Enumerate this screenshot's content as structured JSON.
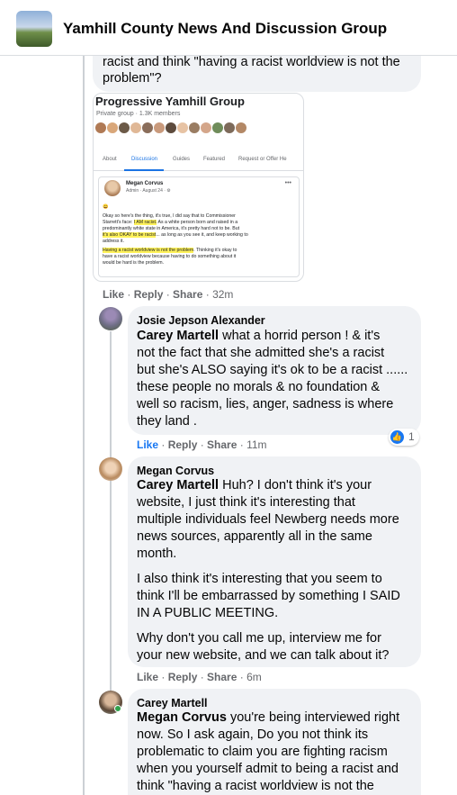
{
  "header": {
    "group_name": "Yamhill County News And Discussion Group",
    "group_thumb_icon": "group-cover-thumbnail"
  },
  "top_comment": {
    "text_cut": "racist and think \"having a racist worldview is not the problem\"?",
    "attachment": {
      "group_name": "Progressive Yamhill Group",
      "meta": "Private group · 1.3K members",
      "tabs": [
        "About",
        "Discussion",
        "Guides",
        "Featured",
        "Request or Offer He"
      ],
      "active_tab": "Discussion",
      "post": {
        "author": "Megan Corvus",
        "meta": "Admin · August 24 · ⚙",
        "emoji": "😀",
        "line1": "Okay so here's the thing, it's true, I did say that to Commissioner",
        "line2a": "Starrett's face: ",
        "line2b": "I AM racist.",
        "line2c": " As a white person born and raised in a",
        "line3": "predominantly white state in America, it's pretty hard not to be. But",
        "line4a": "it's also OKAY to be racist",
        "line4b": "... as long as you see it, and keep working to",
        "line5": "address it.",
        "line6a": "Having a racist worldview is not the problem",
        "line6b": ". Thinking it's okay to",
        "line7": "have a racist worldview because having to do something about it",
        "line8": "would be hard is the problem."
      }
    },
    "actions": {
      "like": "Like",
      "reply": "Reply",
      "share": "Share",
      "time": "32m"
    }
  },
  "comments": [
    {
      "author": "Josie Jepson Alexander",
      "mention": "Carey Martell",
      "text": " what a horrid person ! & it's not the fact that she admitted she's a racist but she's ALSO saying it's ok to be a racist ...... these people no morals & no foundation & well so racism, lies, anger, sadness is where they land .",
      "lines": [
        "what a horrid person ! & it's",
        "not the fact that she admitted she's a racist",
        "but she's ALSO saying it's ok to be a racist ......",
        "these people no morals & no foundation &",
        "well so racism, lies, anger, sadness is where",
        "they land ."
      ],
      "actions": {
        "like": "Like",
        "reply": "Reply",
        "share": "Share",
        "time": "11m"
      },
      "reactions": {
        "count": "1",
        "icon": "thumbs-up-icon"
      }
    },
    {
      "author": "Megan Corvus",
      "mention": "Carey Martell",
      "lines": [
        "Huh? I don't think it's your",
        "website, I just think it's interesting that",
        "multiple individuals feel Newberg needs more",
        "news sources, apparently all in the same",
        "month."
      ],
      "para2": [
        "I also think it's interesting that you seem to",
        "think I'll be embarrassed by something I SAID",
        "IN A PUBLIC MEETING."
      ],
      "para3": [
        "Why don't you call me up, interview me for",
        "your new website, and we can talk about it?"
      ],
      "actions": {
        "like": "Like",
        "reply": "Reply",
        "share": "Share",
        "time": "6m"
      }
    },
    {
      "author": "Carey Martell",
      "mention": "Megan Corvus",
      "lines": [
        "you're being interviewed right",
        "now. So I ask again, Do you not think its",
        "problematic to claim you are fighting racism",
        "when you yourself admit to being a racist and",
        "think \"having a racist worldview is not the"
      ]
    }
  ],
  "colors": {
    "accent": "#1877f2",
    "bubble": "#f0f2f5",
    "meta": "#65676b",
    "online": "#31a24c"
  }
}
